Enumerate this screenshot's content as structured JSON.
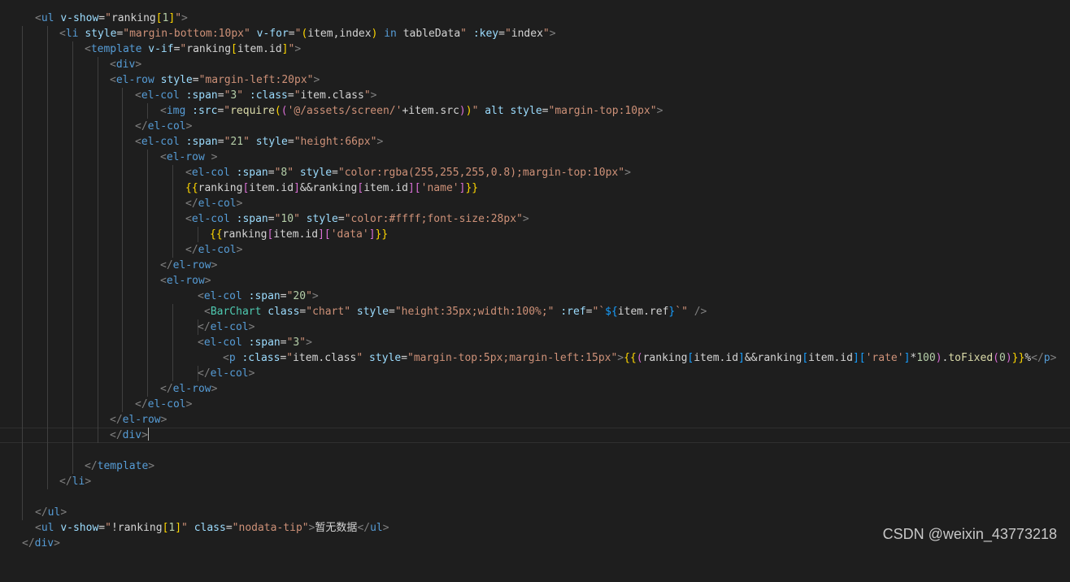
{
  "editor": {
    "lines": [
      "<ul v-show=\"ranking[1]\">",
      "<li style=\"margin-bottom:10px\" v-for=\"(item,index) in tableData\" :key=\"index\">",
      "<template v-if=\"ranking[item.id]\">",
      "<div>",
      "<el-row style=\"margin-left:20px\">",
      "<el-col :span=\"3\" :class=\"item.class\">",
      "<img :src=\"require(('@/assets/screen/'+item.src))\" alt style=\"margin-top:10px\">",
      "</el-col>",
      "<el-col :span=\"21\" style=\"height:66px\">",
      "<el-row >",
      "<el-col :span=\"8\" style=\"color:rgba(255,255,255,0.8);margin-top:10px\">",
      "{{ranking[item.id]&&ranking[item.id]['name']}}",
      "</el-col>",
      "<el-col :span=\"10\" style=\"color:#ffff;font-size:28px\">",
      "{{ranking[item.id]['data']}}",
      "</el-col>",
      "</el-row>",
      "<el-row>",
      "<el-col :span=\"20\">",
      "<BarChart class=\"chart\" style=\"height:35px;width:100%;\" :ref=\"`${item.ref}`\" />",
      "</el-col>",
      "<el-col :span=\"3\">",
      "<p :class=\"item.class\" style=\"margin-top:5px;margin-left:15px\">{{(ranking[item.id]&&ranking[item.id]['rate']*100).toFixed(0)}}%</p>",
      "</el-col>",
      "</el-row>",
      "</el-col>",
      "</el-row>",
      "</div>",
      "",
      "</template>",
      "</li>",
      "",
      "</ul>",
      "<ul v-show=\"!ranking[1]\" class=\"nodata-tip\">暂无数据</ul>",
      "</div>"
    ]
  },
  "watermark": "CSDN @weixin_43773218"
}
